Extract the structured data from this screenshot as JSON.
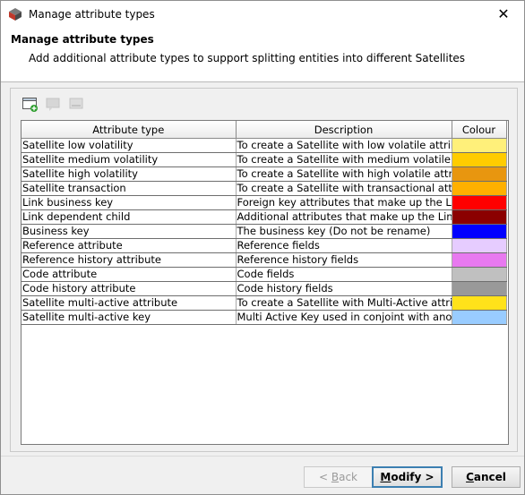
{
  "window": {
    "title": "Manage attribute types",
    "close_glyph": "✕"
  },
  "header": {
    "title": "Manage attribute types",
    "description": "Add additional attribute types to support splitting entities into different Satellites"
  },
  "toolbar": {
    "buttons": [
      {
        "name": "add-attribute-type-button",
        "icon": "add-row-icon",
        "enabled": true
      },
      {
        "name": "edit-attribute-type-button",
        "icon": "comment-icon",
        "enabled": false
      },
      {
        "name": "delete-attribute-type-button",
        "icon": "remove-row-icon",
        "enabled": false
      }
    ]
  },
  "table": {
    "columns": [
      "Attribute type",
      "Description",
      "Colour"
    ],
    "rows": [
      {
        "type": "Satellite low volatility",
        "description": "To create a Satellite with low volatile attrib...",
        "colour": "#fff07a"
      },
      {
        "type": "Satellite medium volatility",
        "description": "To create a Satellite with medium volatile ...",
        "colour": "#ffcc00"
      },
      {
        "type": "Satellite high volatility",
        "description": "To create a Satellite with high volatile attri...",
        "colour": "#e8960f"
      },
      {
        "type": "Satellite transaction",
        "description": "To create a Satellite with transactional attri...",
        "colour": "#ffb000"
      },
      {
        "type": "Link business key",
        "description": "Foreign key attributes that make up the Li...",
        "colour": "#ff0000"
      },
      {
        "type": "Link dependent child",
        "description": "Additional attributes that make up the Link...",
        "colour": "#8b0000"
      },
      {
        "type": "Business key",
        "description": "The business key (Do not be rename)",
        "colour": "#0000ff"
      },
      {
        "type": "Reference attribute",
        "description": "Reference fields",
        "colour": "#e6ccff"
      },
      {
        "type": "Reference history attribute",
        "description": "Reference history fields",
        "colour": "#e879f0"
      },
      {
        "type": "Code attribute",
        "description": "Code fields",
        "colour": "#c0c0c0"
      },
      {
        "type": "Code history attribute",
        "description": "Code history fields",
        "colour": "#999999"
      },
      {
        "type": "Satellite multi-active attribute",
        "description": "To create a Satellite with Multi-Active attrib...",
        "colour": "#ffe21a"
      },
      {
        "type": "Satellite multi-active key",
        "description": "Multi Active Key used in conjoint with anot...",
        "colour": "#99ccff"
      }
    ]
  },
  "buttons": {
    "back_arrow": "< ",
    "back_mnemonic": "B",
    "back_rest": "ack",
    "modify_mnemonic": "M",
    "modify_rest": "odify >",
    "cancel_mnemonic": "C",
    "cancel_rest": "ancel"
  },
  "colors": {
    "accent": "#3c7fb1",
    "header_bg": "#ffffff",
    "window_bg": "#f0f0f0"
  }
}
